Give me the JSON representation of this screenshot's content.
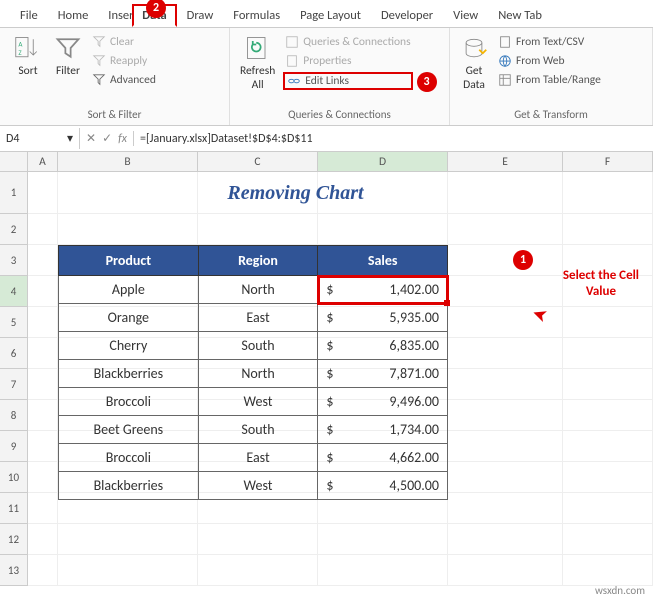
{
  "tabs": [
    "File",
    "Home",
    "Insert",
    "Data",
    "Draw",
    "Formulas",
    "Page Layout",
    "Developer",
    "View",
    "New Tab"
  ],
  "activeTab": "Data",
  "ribbon": {
    "sortFilter": {
      "sort": "Sort",
      "filter": "Filter",
      "clear": "Clear",
      "reapply": "Reapply",
      "advanced": "Advanced",
      "groupLabel": "Sort & Filter"
    },
    "queries": {
      "refresh": "Refresh\nAll",
      "qc": "Queries & Connections",
      "props": "Properties",
      "editLinks": "Edit Links",
      "groupLabel": "Queries & Connections"
    },
    "getTransform": {
      "getData": "Get\nData",
      "fromTextCsv": "From Text/CSV",
      "fromWeb": "From Web",
      "fromTable": "From Table/Range",
      "groupLabel": "Get & Transform"
    }
  },
  "nameBox": "D4",
  "formula": "=[January.xlsx]Dataset!$D$4:$D$11",
  "columns": [
    "A",
    "B",
    "C",
    "D",
    "E",
    "F"
  ],
  "rows": [
    "1",
    "2",
    "3",
    "4",
    "5",
    "6",
    "7",
    "8",
    "9",
    "10",
    "11",
    "12",
    "13"
  ],
  "title": "Removing Chart",
  "headers": {
    "product": "Product",
    "region": "Region",
    "sales": "Sales"
  },
  "data": [
    {
      "product": "Apple",
      "region": "North",
      "sales": "1,402.00"
    },
    {
      "product": "Orange",
      "region": "East",
      "sales": "5,935.00"
    },
    {
      "product": "Cherry",
      "region": "South",
      "sales": "6,835.00"
    },
    {
      "product": "Blackberries",
      "region": "North",
      "sales": "7,871.00"
    },
    {
      "product": "Broccoli",
      "region": "West",
      "sales": "9,496.00"
    },
    {
      "product": "Beet Greens",
      "region": "South",
      "sales": "1,734.00"
    },
    {
      "product": "Broccoli",
      "region": "East",
      "sales": "4,662.00"
    },
    {
      "product": "Blackberries",
      "region": "West",
      "sales": "4,500.00"
    }
  ],
  "callouts": {
    "one": "1",
    "two": "2",
    "three": "3"
  },
  "annotation": {
    "line1": "Select the Cell",
    "line2": "Value"
  },
  "watermark": "wsxdn.com"
}
